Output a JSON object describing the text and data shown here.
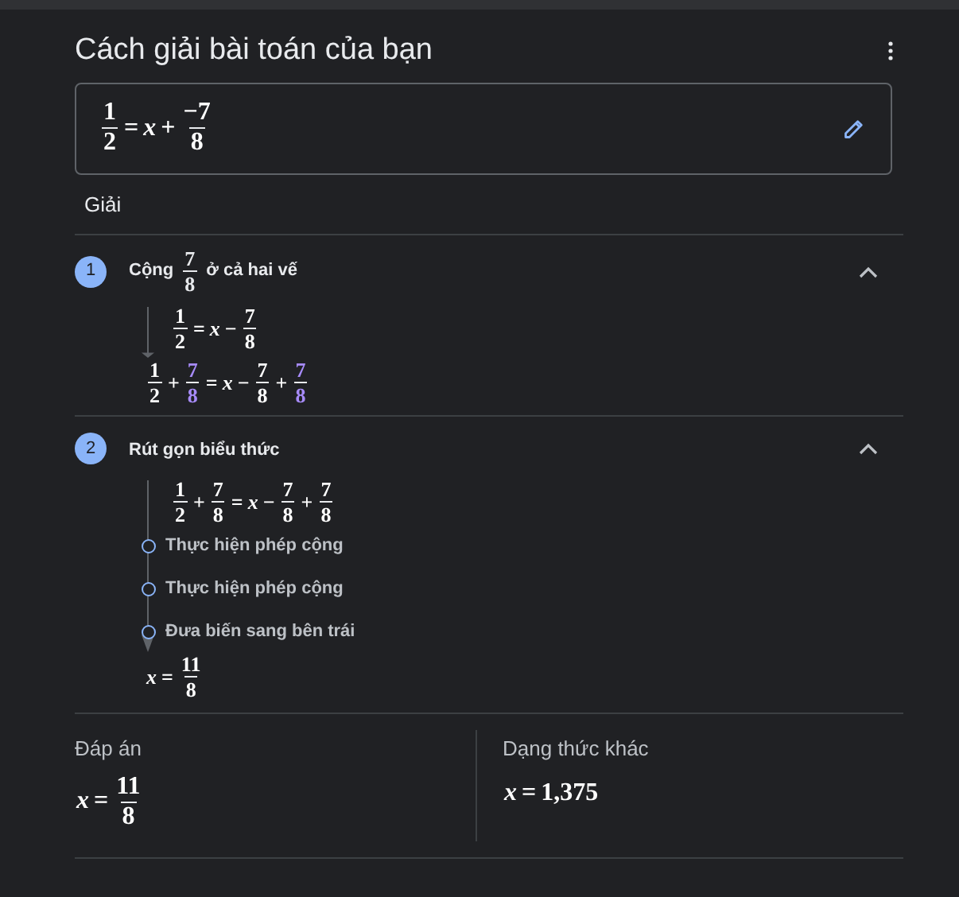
{
  "title": "Cách giải bài toán của bạn",
  "problem": [
    {
      "kind": "frac",
      "numerator": "1",
      "denominator": "2"
    },
    {
      "kind": "op",
      "value": "="
    },
    {
      "kind": "var",
      "value": "x"
    },
    {
      "kind": "op",
      "value": "+"
    },
    {
      "kind": "frac",
      "numerator": "−7",
      "denominator": "8"
    }
  ],
  "section_label": "Giải",
  "steps": [
    {
      "number": "1",
      "expanded": true,
      "title": [
        {
          "kind": "text",
          "value": "Cộng"
        },
        {
          "kind": "frac",
          "numerator": "7",
          "denominator": "8"
        },
        {
          "kind": "text",
          "value": "ở cả hai vế"
        }
      ],
      "items": [
        {
          "kind": "equation",
          "math": [
            {
              "kind": "frac",
              "numerator": "1",
              "denominator": "2"
            },
            {
              "kind": "op",
              "value": "="
            },
            {
              "kind": "var",
              "value": "x"
            },
            {
              "kind": "op",
              "value": "−"
            },
            {
              "kind": "frac",
              "numerator": "7",
              "denominator": "8"
            }
          ]
        },
        {
          "kind": "result",
          "math": [
            {
              "kind": "frac",
              "numerator": "1",
              "denominator": "2"
            },
            {
              "kind": "op",
              "value": "+"
            },
            {
              "kind": "frac",
              "numerator": "7",
              "denominator": "8",
              "color": "#a78bfa"
            },
            {
              "kind": "op",
              "value": "="
            },
            {
              "kind": "var",
              "value": "x"
            },
            {
              "kind": "op",
              "value": "−"
            },
            {
              "kind": "frac",
              "numerator": "7",
              "denominator": "8"
            },
            {
              "kind": "op",
              "value": "+"
            },
            {
              "kind": "frac",
              "numerator": "7",
              "denominator": "8",
              "color": "#a78bfa"
            }
          ]
        }
      ]
    },
    {
      "number": "2",
      "expanded": true,
      "title": [
        {
          "kind": "text",
          "value": "Rút gọn biểu thức"
        }
      ],
      "items": [
        {
          "kind": "equation",
          "math": [
            {
              "kind": "frac",
              "numerator": "1",
              "denominator": "2"
            },
            {
              "kind": "op",
              "value": "+"
            },
            {
              "kind": "frac",
              "numerator": "7",
              "denominator": "8"
            },
            {
              "kind": "op",
              "value": "="
            },
            {
              "kind": "var",
              "value": "x"
            },
            {
              "kind": "op",
              "value": "−"
            },
            {
              "kind": "frac",
              "numerator": "7",
              "denominator": "8"
            },
            {
              "kind": "op",
              "value": "+"
            },
            {
              "kind": "frac",
              "numerator": "7",
              "denominator": "8"
            }
          ]
        },
        {
          "kind": "substep",
          "text": "Thực hiện phép cộng"
        },
        {
          "kind": "substep",
          "text": "Thực hiện phép cộng"
        },
        {
          "kind": "substep",
          "text": "Đưa biến sang bên trái"
        },
        {
          "kind": "result",
          "math": [
            {
              "kind": "var",
              "value": "x"
            },
            {
              "kind": "op",
              "value": "="
            },
            {
              "kind": "frac",
              "numerator": "11",
              "denominator": "8"
            }
          ]
        }
      ]
    }
  ],
  "answers": [
    {
      "label": "Đáp án",
      "math": [
        {
          "kind": "var",
          "value": "x"
        },
        {
          "kind": "op",
          "value": "="
        },
        {
          "kind": "frac",
          "numerator": "11",
          "denominator": "8"
        }
      ]
    },
    {
      "label": "Dạng thức khác",
      "math": [
        {
          "kind": "var",
          "value": "x"
        },
        {
          "kind": "op",
          "value": "="
        },
        {
          "kind": "num",
          "value": "1,375"
        }
      ]
    }
  ]
}
